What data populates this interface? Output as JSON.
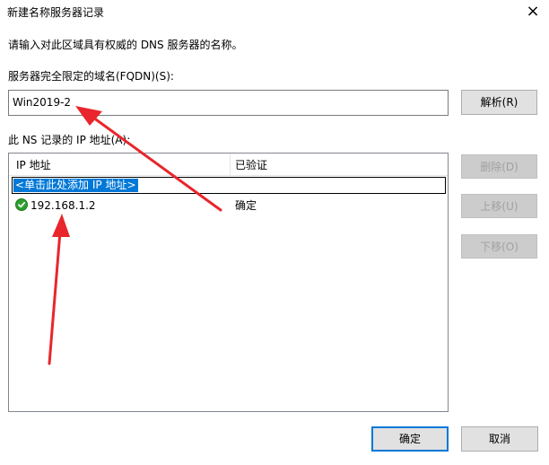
{
  "window": {
    "title": "新建名称服务器记录",
    "close_glyph": "×"
  },
  "instruction": "请输入对此区域具有权威的 DNS 服务器的名称。",
  "fqdn": {
    "label": "服务器完全限定的域名(FQDN)(S):",
    "value": "Win2019-2",
    "resolve_button": "解析(R)"
  },
  "ip_section": {
    "label": "此 NS 记录的 IP 地址(A):",
    "columns": [
      "IP 地址",
      "已验证"
    ],
    "add_placeholder": "<单击此处添加 IP 地址>",
    "rows": [
      {
        "ip": "192.168.1.2",
        "verified": "确定",
        "status_icon": "check-circle-icon"
      }
    ]
  },
  "side_buttons": {
    "delete": "删除(D)",
    "up": "上移(U)",
    "down": "下移(O)"
  },
  "footer": {
    "ok": "确定",
    "cancel": "取消"
  },
  "colors": {
    "selection": "#0078d7",
    "annotation_arrow": "#e8262b",
    "status_ok": "#2e9e2e"
  }
}
